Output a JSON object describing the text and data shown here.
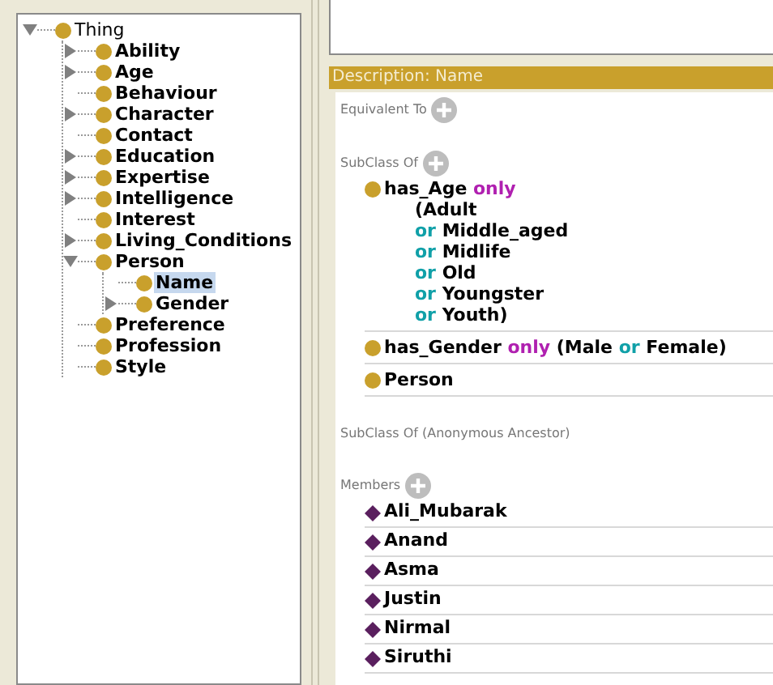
{
  "tree": [
    {
      "label": "Thing",
      "kind": "branch",
      "expanded": true,
      "selected": false,
      "children": [
        {
          "label": "Ability",
          "kind": "branch",
          "expanded": false,
          "selected": false
        },
        {
          "label": "Age",
          "kind": "branch",
          "expanded": false,
          "selected": false
        },
        {
          "label": "Behaviour",
          "kind": "leaf",
          "selected": false
        },
        {
          "label": "Character",
          "kind": "branch",
          "expanded": false,
          "selected": false
        },
        {
          "label": "Contact",
          "kind": "leaf",
          "selected": false
        },
        {
          "label": "Education",
          "kind": "branch",
          "expanded": false,
          "selected": false
        },
        {
          "label": "Expertise",
          "kind": "branch",
          "expanded": false,
          "selected": false
        },
        {
          "label": "Intelligence",
          "kind": "branch",
          "expanded": false,
          "selected": false
        },
        {
          "label": "Interest",
          "kind": "leaf",
          "selected": false
        },
        {
          "label": "Living_Conditions",
          "kind": "branch",
          "expanded": false,
          "selected": false
        },
        {
          "label": "Person",
          "kind": "branch",
          "expanded": true,
          "selected": false,
          "children": [
            {
              "label": "Name",
              "kind": "leaf",
              "selected": true
            },
            {
              "label": "Gender",
              "kind": "branch",
              "expanded": false,
              "selected": false
            }
          ]
        },
        {
          "label": "Preference",
          "kind": "leaf",
          "selected": false
        },
        {
          "label": "Profession",
          "kind": "leaf",
          "selected": false
        },
        {
          "label": "Style",
          "kind": "leaf",
          "selected": false
        }
      ]
    }
  ],
  "description": {
    "title": "Description: Name",
    "equivalent_to": {
      "label": "Equivalent To"
    },
    "subclass_of": {
      "label": "SubClass Of",
      "items": [
        {
          "lines": [
            [
              {
                "text": "has_Age",
                "kind": "name"
              },
              {
                "text": "only",
                "kind": "only"
              }
            ],
            [
              {
                "text": "(Adult",
                "kind": "name"
              }
            ],
            [
              {
                "text": "or",
                "kind": "or"
              },
              {
                "text": "Middle_aged",
                "kind": "name"
              }
            ],
            [
              {
                "text": "or",
                "kind": "or"
              },
              {
                "text": "Midlife",
                "kind": "name"
              }
            ],
            [
              {
                "text": "or",
                "kind": "or"
              },
              {
                "text": "Old",
                "kind": "name"
              }
            ],
            [
              {
                "text": "or",
                "kind": "or"
              },
              {
                "text": "Youngster",
                "kind": "name"
              }
            ],
            [
              {
                "text": "or",
                "kind": "or"
              },
              {
                "text": "Youth)",
                "kind": "name"
              }
            ]
          ]
        },
        {
          "lines": [
            [
              {
                "text": "has_Gender",
                "kind": "name"
              },
              {
                "text": "only",
                "kind": "only"
              },
              {
                "text": "(Male",
                "kind": "name"
              },
              {
                "text": "or",
                "kind": "or"
              },
              {
                "text": "Female)",
                "kind": "name"
              }
            ]
          ]
        },
        {
          "lines": [
            [
              {
                "text": "Person",
                "kind": "name"
              }
            ]
          ]
        }
      ]
    },
    "anonymous_ancestor": {
      "label": "SubClass Of (Anonymous Ancestor)"
    },
    "members": {
      "label": "Members",
      "items": [
        "Ali_Mubarak",
        "Anand",
        "Asma",
        "Justin",
        "Nirmal",
        "Siruthi"
      ]
    }
  }
}
